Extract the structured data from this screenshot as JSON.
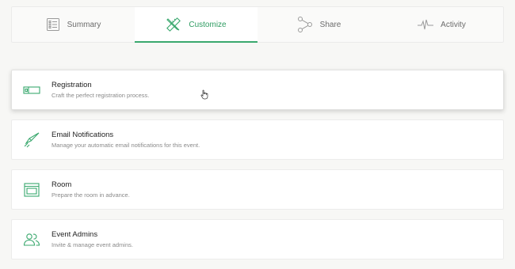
{
  "tabs": [
    {
      "label": "Summary",
      "icon": "summary-list-icon",
      "active": false
    },
    {
      "label": "Customize",
      "icon": "ruler-pencil-icon",
      "active": true
    },
    {
      "label": "Share",
      "icon": "share-nodes-icon",
      "active": false
    },
    {
      "label": "Activity",
      "icon": "activity-pulse-icon",
      "active": false
    }
  ],
  "cards": [
    {
      "title": "Registration",
      "desc": "Craft the perfect registration process.",
      "icon": "ticket-icon"
    },
    {
      "title": "Email Notifications",
      "desc": "Manage your automatic email notifications for this event.",
      "icon": "paper-plane-icon"
    },
    {
      "title": "Room",
      "desc": "Prepare the room in advance.",
      "icon": "room-layout-icon"
    },
    {
      "title": "Event Admins",
      "desc": "Invite & manage event admins.",
      "icon": "users-icon"
    }
  ],
  "colors": {
    "accent": "#3aa86e",
    "icon_gray": "#9a9a9a"
  }
}
